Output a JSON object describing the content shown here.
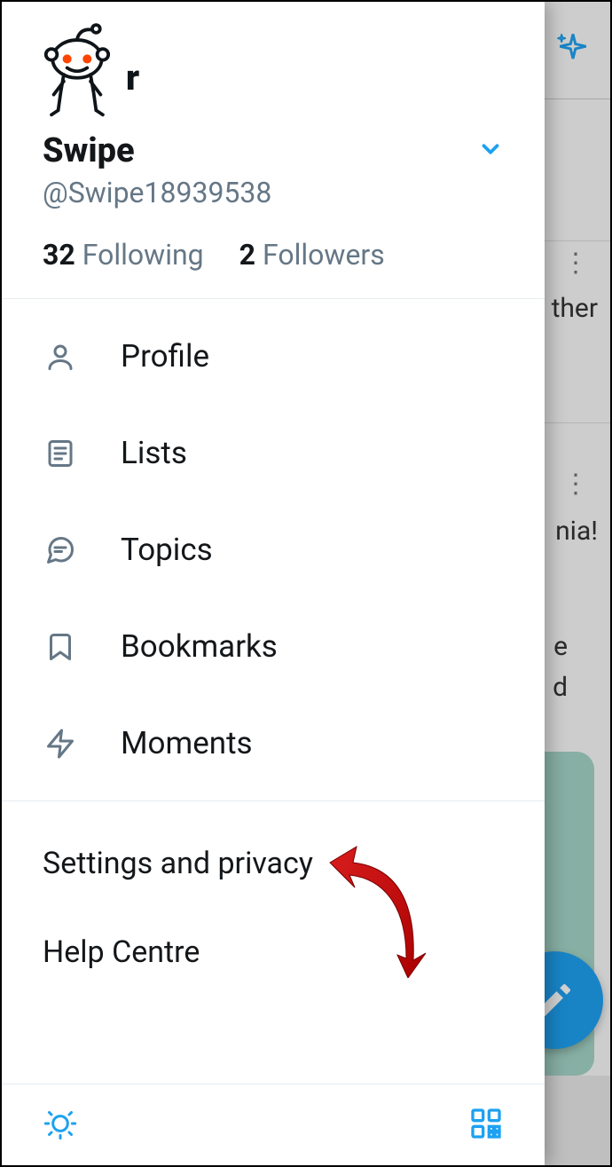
{
  "profile": {
    "display_name": "Swipe",
    "handle": "@Swipe18939538",
    "following_count": "32",
    "following_label": "Following",
    "followers_count": "2",
    "followers_label": "Followers"
  },
  "menu": {
    "profile": "Profile",
    "lists": "Lists",
    "topics": "Topics",
    "bookmarks": "Bookmarks",
    "moments": "Moments"
  },
  "secondary_menu": {
    "settings": "Settings and privacy",
    "help": "Help Centre"
  },
  "background": {
    "text_fragment_1": "ther",
    "text_fragment_2": "nia!",
    "text_fragment_3": "e",
    "text_fragment_4": "d"
  },
  "annotation": {
    "target": "settings-and-privacy"
  }
}
